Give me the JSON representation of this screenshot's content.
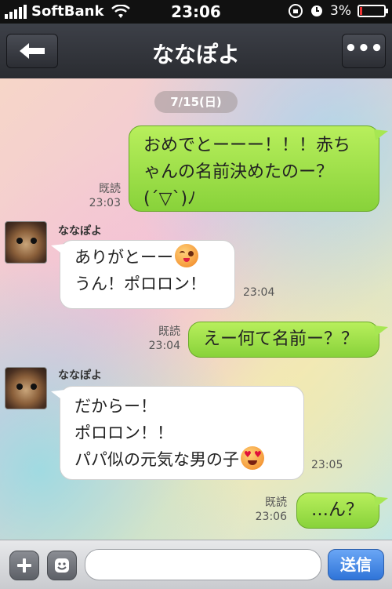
{
  "status_bar": {
    "carrier": "SoftBank",
    "time": "23:06",
    "battery_percent": "3%"
  },
  "header": {
    "title": "ななぽよ",
    "more_label": "•••"
  },
  "chat": {
    "date": "7/15(日)",
    "messages": [
      {
        "from": "me",
        "text": "おめでとーーー！！！赤ちゃんの名前決めたのー？(´▽`)ﾉ",
        "read": "既読",
        "time": "23:03"
      },
      {
        "from": "them",
        "sender": "ななぽよ",
        "line1": "ありがとーー",
        "line2": "うん！ポロロン！",
        "time": "23:04",
        "emoji": "winking-face"
      },
      {
        "from": "me",
        "text": "えー何て名前ー？？",
        "read": "既読",
        "time": "23:04"
      },
      {
        "from": "them",
        "sender": "ななぽよ",
        "line1": "だからー！",
        "line2": "ポロロン！！",
        "line3": "パパ似の元気な男の子",
        "time": "23:05",
        "emoji": "heart-eyes-face"
      },
      {
        "from": "me",
        "text": "…ん？",
        "read": "既読",
        "time": "23:06"
      }
    ]
  },
  "input_bar": {
    "placeholder": "",
    "send_label": "送信"
  },
  "colors": {
    "my_bubble": "#9be04a",
    "send_button": "#3a80e0",
    "header": "#33353b"
  }
}
